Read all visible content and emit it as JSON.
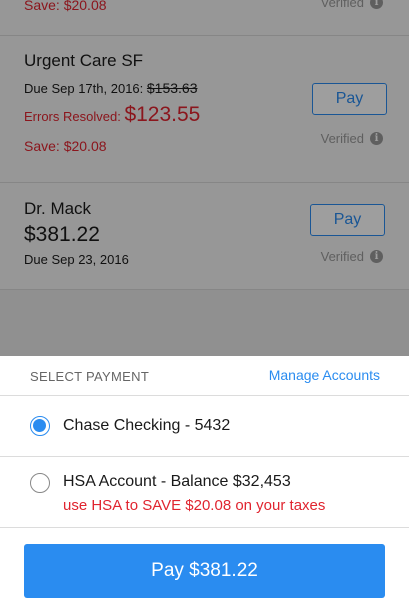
{
  "top_partial": {
    "save_text": "Save: $20.08",
    "verified": "Verified"
  },
  "bills": [
    {
      "provider": "Urgent Care SF",
      "due_prefix": "Due Sep 17th, 2016:",
      "original_amount": "$153.63",
      "errors_label": "Errors Resolved:",
      "resolved_amount": "$123.55",
      "save_text": "Save: $20.08",
      "pay_label": "Pay",
      "verified": "Verified"
    },
    {
      "provider": "Dr. Mack",
      "amount": "$381.22",
      "due": "Due Sep 23, 2016",
      "pay_label": "Pay",
      "verified": "Verified"
    }
  ],
  "sheet": {
    "title": "SELECT PAYMENT",
    "manage": "Manage Accounts",
    "accounts": [
      {
        "label": "Chase Checking - 5432",
        "selected": true
      },
      {
        "label": "HSA Account - Balance $32,453",
        "tip": "use HSA to SAVE $20.08 on your taxes",
        "selected": false
      }
    ],
    "pay_button": "Pay $381.22"
  },
  "colors": {
    "accent": "#2a8cf0",
    "alert": "#e0242f"
  }
}
